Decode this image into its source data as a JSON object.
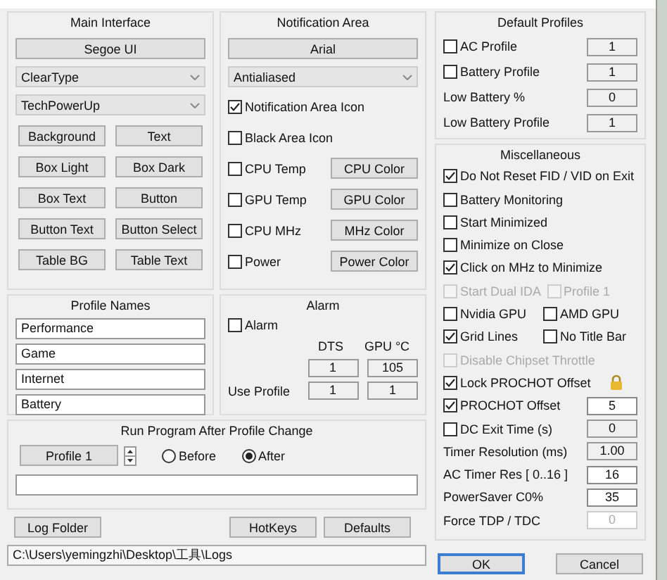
{
  "main_interface": {
    "title": "Main Interface",
    "font_button": "Segoe UI",
    "dropdowns": [
      "ClearType",
      "TechPowerUp"
    ],
    "color_buttons": [
      "Background",
      "Text",
      "Box Light",
      "Box Dark",
      "Box Text",
      "Button",
      "Button Text",
      "Button Select",
      "Table BG",
      "Table Text"
    ]
  },
  "notification_area": {
    "title": "Notification Area",
    "font_button": "Arial",
    "dropdown": "Antialiased",
    "options": [
      {
        "label": "Notification Area Icon",
        "checked": true
      },
      {
        "label": "Black Area Icon",
        "checked": false
      },
      {
        "label": "CPU Temp",
        "checked": false,
        "button": "CPU Color"
      },
      {
        "label": "GPU Temp",
        "checked": false,
        "button": "GPU Color"
      },
      {
        "label": "CPU MHz",
        "checked": false,
        "button": "MHz Color"
      },
      {
        "label": "Power",
        "checked": false,
        "button": "Power Color"
      }
    ]
  },
  "default_profiles": {
    "title": "Default Profiles",
    "rows": [
      {
        "kind": "checkbox",
        "label": "AC Profile",
        "checked": false,
        "value": "1"
      },
      {
        "kind": "checkbox",
        "label": "Battery Profile",
        "checked": false,
        "value": "1"
      },
      {
        "kind": "label",
        "label": "Low Battery %",
        "value": "0"
      },
      {
        "kind": "label",
        "label": "Low Battery Profile",
        "value": "1"
      }
    ]
  },
  "profile_names": {
    "title": "Profile Names",
    "fields": [
      "Performance",
      "Game",
      "Internet",
      "Battery"
    ]
  },
  "alarm": {
    "title": "Alarm",
    "checkbox": {
      "label": "Alarm",
      "checked": false
    },
    "columns": [
      "DTS",
      "GPU °C"
    ],
    "rows": [
      {
        "values": [
          "1",
          "105"
        ]
      },
      {
        "label": "Use Profile",
        "values": [
          "1",
          "1"
        ]
      }
    ]
  },
  "miscellaneous": {
    "title": "Miscellaneous",
    "items": [
      {
        "kind": "checkbox",
        "label": "Do Not Reset FID / VID on Exit",
        "checked": true,
        "disabled": false
      },
      {
        "kind": "checkbox",
        "label": "Battery Monitoring",
        "checked": false,
        "disabled": false
      },
      {
        "kind": "checkbox",
        "label": "Start Minimized",
        "checked": false,
        "disabled": false
      },
      {
        "kind": "checkbox",
        "label": "Minimize on Close",
        "checked": false,
        "disabled": false
      },
      {
        "kind": "checkbox",
        "label": "Click on MHz to Minimize",
        "checked": true,
        "disabled": false
      },
      {
        "kind": "pair",
        "items": [
          {
            "label": "Start Dual IDA",
            "checked": false,
            "disabled": true
          },
          {
            "label": "Profile 1",
            "checked": false,
            "disabled": true
          }
        ]
      },
      {
        "kind": "pair",
        "items": [
          {
            "label": "Nvidia GPU",
            "checked": false,
            "disabled": false
          },
          {
            "label": "AMD GPU",
            "checked": false,
            "disabled": false
          }
        ]
      },
      {
        "kind": "pair",
        "items": [
          {
            "label": "Grid Lines",
            "checked": true,
            "disabled": false
          },
          {
            "label": "No Title Bar",
            "checked": false,
            "disabled": false
          }
        ]
      },
      {
        "kind": "checkbox",
        "label": "Disable Chipset Throttle",
        "checked": false,
        "disabled": true
      },
      {
        "kind": "checkbox",
        "label": "Lock PROCHOT Offset",
        "checked": true,
        "disabled": false,
        "lock": true
      },
      {
        "kind": "checkbox",
        "label": "PROCHOT Offset",
        "checked": true,
        "disabled": false,
        "value": "5",
        "editable": true
      },
      {
        "kind": "checkbox",
        "label": "DC Exit Time (s)",
        "checked": false,
        "disabled": false,
        "value": "0",
        "editable": false
      },
      {
        "kind": "label",
        "label": "Timer Resolution (ms)",
        "value": "1.00",
        "editable": false,
        "disabled": false
      },
      {
        "kind": "label",
        "label": "AC Timer Res [ 0..16 ]",
        "value": "16",
        "editable": true,
        "disabled": false
      },
      {
        "kind": "label",
        "label": "PowerSaver C0%",
        "value": "35",
        "editable": true,
        "disabled": false
      },
      {
        "kind": "label",
        "label": "Force TDP / TDC",
        "value": "0",
        "editable": true,
        "disabled": true
      }
    ]
  },
  "run_program": {
    "title": "Run Program After Profile Change",
    "profile_button": "Profile 1",
    "radios": [
      {
        "label": "Before",
        "selected": false
      },
      {
        "label": "After",
        "selected": true
      }
    ]
  },
  "bottom": {
    "buttons": [
      "Log Folder",
      "HotKeys",
      "Defaults"
    ],
    "path": "C:\\Users\\yemingzhi\\Desktop\\工具\\Logs"
  },
  "dialog_buttons": [
    {
      "label": "OK",
      "default": true
    },
    {
      "label": "Cancel",
      "default": false
    }
  ]
}
